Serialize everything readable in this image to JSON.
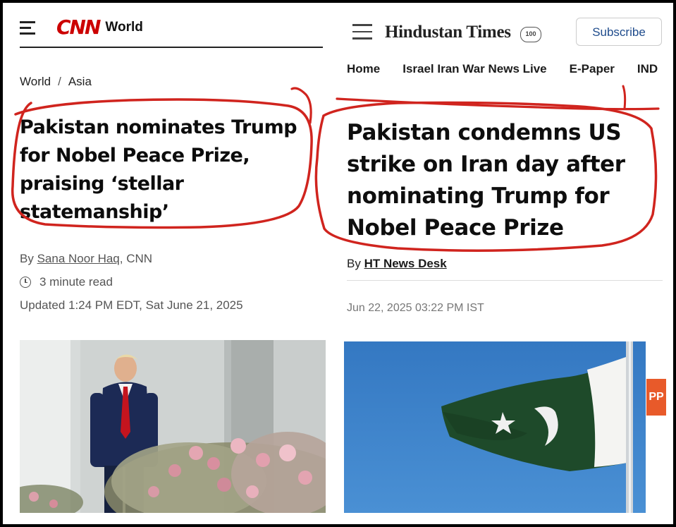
{
  "cnn": {
    "logo": "CNN",
    "section": "World",
    "breadcrumb": [
      "World",
      "/",
      "Asia"
    ],
    "title": "Pakistan nominates Trump for Nobel Peace Prize, praising ‘stellar statemanship’",
    "byline_prefix": "By ",
    "byline_name": "Sana Noor Haq",
    "byline_suffix": ", CNN",
    "read_time": "3 minute read",
    "updated": "Updated 1:24 PM EDT, Sat June 21, 2025"
  },
  "ht": {
    "logo": "Hindustan Times",
    "badge": "100",
    "subscribe_label": "Subscribe",
    "nav": [
      "Home",
      "Israel Iran War News Live",
      "E-Paper",
      "IND"
    ],
    "title": "Pakistan condemns US strike on Iran day after nominating Trump for Nobel Peace Prize",
    "byline_prefix": "By ",
    "byline_name": "HT News Desk",
    "date": "Jun 22, 2025 03:22 PM IST",
    "side_tab": "PP"
  },
  "icons": {
    "menu": "hamburger-icon",
    "clock": "clock-icon"
  },
  "colors": {
    "cnn_red": "#cc0000",
    "annotation_red": "#d0241e",
    "ht_link": "#1e4b8c"
  }
}
